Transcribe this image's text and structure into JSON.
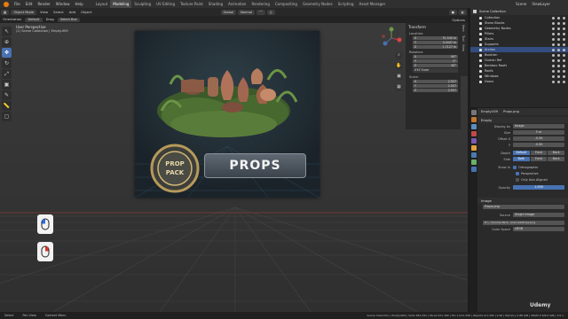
{
  "menubar": {
    "menus": [
      "File",
      "Edit",
      "Render",
      "Window",
      "Help"
    ],
    "workspaces": [
      "Layout",
      "Modeling",
      "Sculpting",
      "UV Editing",
      "Texture Paint",
      "Shading",
      "Animation",
      "Rendering",
      "Compositing",
      "Geometry Nodes",
      "Scripting",
      "Asset Manager"
    ],
    "active_workspace": "Modeling",
    "scene": "Scene",
    "view_layer": "ViewLayer"
  },
  "header": {
    "mode": "Object Mode",
    "menus": [
      "View",
      "Select",
      "Add",
      "Object"
    ],
    "orientation": "Global",
    "pivot": "Normal",
    "options": "Options"
  },
  "tool_options": {
    "orientation_label": "Orientation",
    "orientation_value": "Default",
    "drag_label": "Drag",
    "drag_value": "Select Box"
  },
  "viewport": {
    "view_name": "User Perspective",
    "collection_path": "(1) Scene Collection | Empty.009",
    "banner_text": "PROPS",
    "badge_lines": [
      "PROP",
      "PACK"
    ]
  },
  "npanel": {
    "transform_title": "Transform",
    "location_label": "Location:",
    "location": [
      [
        "X",
        "51.545 m"
      ],
      [
        "Y",
        "4.4447 m"
      ],
      [
        "Z",
        "1.7127 m"
      ]
    ],
    "rotation_label": "Rotation:",
    "rotation": [
      [
        "X",
        "90°"
      ],
      [
        "Y",
        "0°"
      ],
      [
        "Z",
        "90°"
      ]
    ],
    "rotation_mode": "XYZ Euler",
    "scale_label": "Scale:",
    "scale": [
      [
        "X",
        "2.557"
      ],
      [
        "Y",
        "2.557"
      ],
      [
        "Z",
        "2.557"
      ]
    ],
    "tabs": [
      "Item",
      "Tool",
      "View"
    ]
  },
  "outliner": {
    "header": "Scene Collection",
    "items": [
      "Collection",
      "Stone Blocks",
      "Geometry Nodes",
      "Pillars",
      "Stairs",
      "Supports",
      "Arches",
      "Bookran",
      "Human Ref",
      "Bamboo Roofs",
      "Roofs",
      "Windows",
      "Doors"
    ],
    "selected_index": 6
  },
  "properties": {
    "object_name": "Empty.009",
    "image_name": "Props.png",
    "section_empty": "Empty",
    "display_as_label": "Display As",
    "display_as_value": "Image",
    "size_label": "Size",
    "size_value": "5 m",
    "offset_x_label": "Offset X",
    "offset_x_value": "-0.50",
    "offset_y_label": "Y",
    "offset_y_value": "-0.50",
    "depth_label": "Depth",
    "depth_options": [
      "Default",
      "Front",
      "Back"
    ],
    "side_label": "Side",
    "side_options": [
      "Both",
      "Front",
      "Back"
    ],
    "show_in_label": "Show In",
    "show_in_options": [
      "Orthographic",
      "Perspective",
      "Only Axis Aligned"
    ],
    "opacity_label": "Opacity",
    "opacity_value": "1.000",
    "section_image": "Image",
    "image_field": "Props.png",
    "source_label": "Source",
    "source_value": "Single Image",
    "filepath": "D:\\...\\Course Pack...erences\\Props.png",
    "color_space_label": "Color Space",
    "color_space_value": "sRGB"
  },
  "statusbar": {
    "left": [
      "Select",
      "Pan View",
      "Context Menu"
    ],
    "stats": "Scene Collection | Empty.009 | Verts 651,291 | Faces 521,160 | Tris 1,011,328 | Objects 0/1,305 | 2.90 | Memory 2.86 GiB | VRAM 2.5/6.0 GiB | 3.6.1"
  },
  "watermark": "Udemy",
  "colors": {
    "accent": "#4772b3",
    "selected_row": "#334d80",
    "brand_orange": "#e87d0d"
  }
}
